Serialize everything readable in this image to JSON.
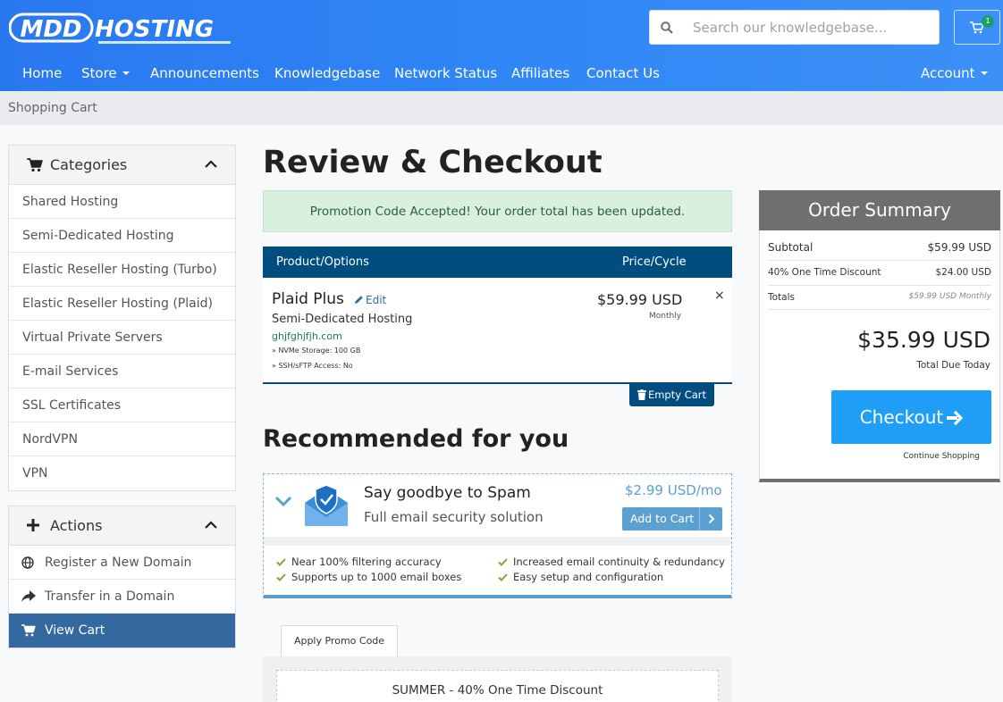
{
  "brand": {
    "logo_text": "MDDHOSTING"
  },
  "header": {
    "search_placeholder": "Search our knowledgebase...",
    "cart_count": "1"
  },
  "nav": {
    "home": "Home",
    "store": "Store",
    "announcements": "Announcements",
    "knowledgebase": "Knowledgebase",
    "network_status": "Network Status",
    "affiliates": "Affiliates",
    "contact_us": "Contact Us",
    "account": "Account"
  },
  "breadcrumb": "Shopping Cart",
  "sidebar": {
    "categories_title": "Categories",
    "categories": [
      "Shared Hosting",
      "Semi-Dedicated Hosting",
      "Elastic Reseller Hosting (Turbo)",
      "Elastic Reseller Hosting (Plaid)",
      "Virtual Private Servers",
      "E-mail Services",
      "SSL Certificates",
      "NordVPN",
      "VPN"
    ],
    "actions_title": "Actions",
    "actions": [
      "Register a New Domain",
      "Transfer in a Domain",
      "View Cart"
    ]
  },
  "main": {
    "title": "Review & Checkout",
    "promo_alert": "Promotion Code Accepted! Your order total has been updated.",
    "table_headers": {
      "product": "Product/Options",
      "price": "Price/Cycle"
    },
    "product": {
      "name": "Plaid Plus",
      "edit": "Edit",
      "group": "Semi-Dedicated Hosting",
      "domain": "ghjfghjfjh.com",
      "options": [
        "» NVMe Storage: 100 GB",
        "» SSH/sFTP Access: No"
      ],
      "price": "$59.99 USD",
      "cycle": "Monthly",
      "remove": "×"
    },
    "empty_cart": "Empty Cart",
    "recommended_title": "Recommended for you",
    "recommendation": {
      "name": "Say goodbye to Spam",
      "description": "Full email security solution",
      "price": "$2.99 USD/mo",
      "add_label": "Add to Cart",
      "features": [
        "Near 100% filtering accuracy",
        "Supports up to 1000 email boxes",
        "Increased email continuity & redundancy",
        "Easy setup and configuration"
      ]
    },
    "promo_tab": "Apply Promo Code",
    "promo_applied": "SUMMER - 40% One Time Discount"
  },
  "summary": {
    "title": "Order Summary",
    "subtotal_label": "Subtotal",
    "subtotal_value": "$59.99 USD",
    "discount_label": "40% One Time Discount",
    "discount_value": "$24.00 USD",
    "totals_label": "Totals",
    "totals_value": "$59.99 USD Monthly",
    "total_due": "$35.99 USD",
    "total_due_label": "Total Due Today",
    "checkout": "Checkout",
    "continue": "Continue Shopping"
  },
  "colors": {
    "header_blue": "#2f86f5",
    "table_navy": "#004d7f",
    "checkout_blue": "#1f9ef7",
    "active_item": "#33699e",
    "alert_green": "#d9efe0"
  }
}
